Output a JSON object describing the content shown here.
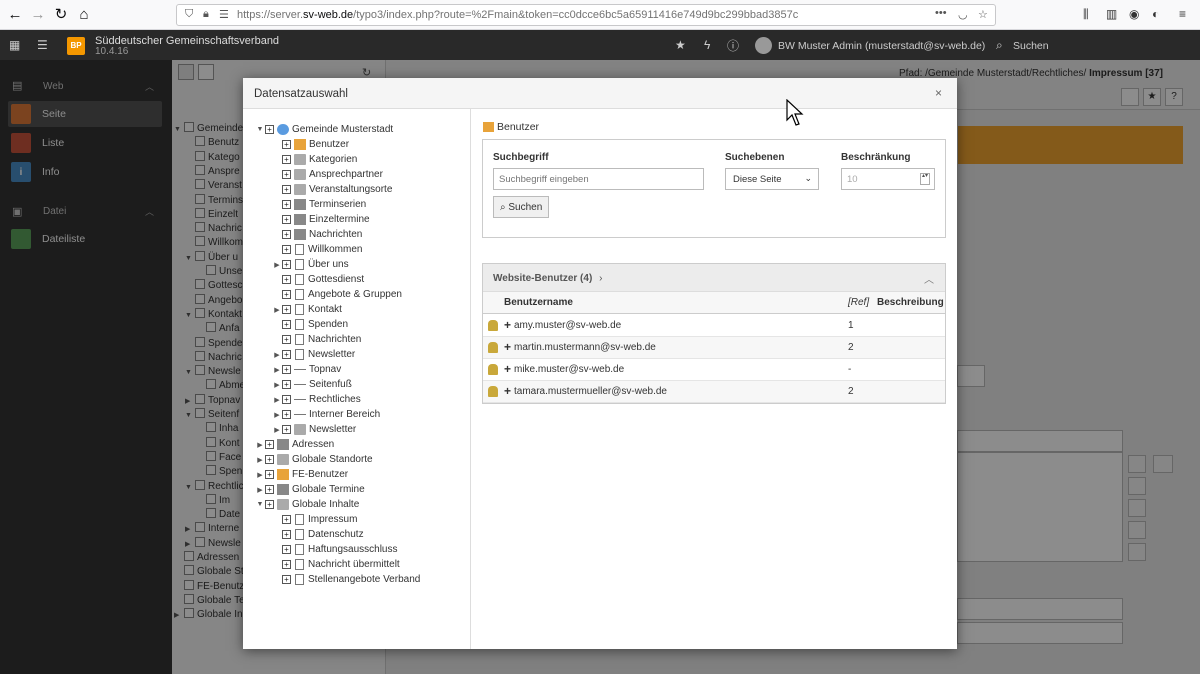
{
  "browser": {
    "url_prefix": "https://server.",
    "url_domain": "sv-web.de",
    "url_path": "/typo3/index.php?route=%2Fmain&token=cc0dcce6bc5a65911416e749d9bc299bbad3857c",
    "menu_dots": "•••"
  },
  "topbar": {
    "logo_text": "BP",
    "site_name": "Süddeutscher Gemeinschaftsverband",
    "site_version": "10.4.16",
    "user": "BW Muster Admin (musterstadt@sv-web.de)",
    "search_label": "Suchen"
  },
  "modules": {
    "group_web": "Web",
    "seite": "Seite",
    "liste": "Liste",
    "info": "Info",
    "group_datei": "Datei",
    "dateiliste": "Dateiliste",
    "colors": {
      "seite": "#e07b39",
      "liste": "#c8553d",
      "info": "#4a8ec9",
      "dateiliste": "#5ca35c"
    }
  },
  "bg_tree": [
    "Gemeinde",
    "Benutz",
    "Katego",
    "Anspre",
    "Veranst",
    "Termins",
    "Einzelt",
    "Nachric",
    "Willkom",
    "Über u",
    "Unse",
    "Gottesc",
    "Angebo",
    "Kontakt",
    "Anfa",
    "Spende",
    "Nachric",
    "Newsle",
    "Abme",
    "Topnav",
    "Seitenf",
    "Inha",
    "Kont",
    "Face",
    "Spen",
    "Rechtlic",
    "Im",
    "Date",
    "Interne",
    "Newsle",
    "Adressen",
    "Globale St",
    "FE-Benutz",
    "Globale Te",
    "Globale In"
  ],
  "docheader": {
    "path_label": "Pfad: /Gemeinde Musterstadt/Rechtliches/",
    "page": "Impressum [37]"
  },
  "modal": {
    "title": "Datensatzauswahl",
    "close": "×",
    "tree": [
      {
        "label": "Gemeinde Musterstadt",
        "icon": "globe",
        "level": 0,
        "arrow": "▼"
      },
      {
        "label": "Benutzer",
        "icon": "user",
        "level": 1,
        "arrow": ""
      },
      {
        "label": "Kategorien",
        "icon": "folder",
        "level": 1,
        "arrow": ""
      },
      {
        "label": "Ansprechpartner",
        "icon": "folder",
        "level": 1,
        "arrow": ""
      },
      {
        "label": "Veranstaltungsorte",
        "icon": "folder",
        "level": 1,
        "arrow": ""
      },
      {
        "label": "Terminserien",
        "icon": "sys",
        "level": 1,
        "arrow": ""
      },
      {
        "label": "Einzeltermine",
        "icon": "sys",
        "level": 1,
        "arrow": ""
      },
      {
        "label": "Nachrichten",
        "icon": "sys",
        "level": 1,
        "arrow": ""
      },
      {
        "label": "Willkommen",
        "icon": "page",
        "level": 1,
        "arrow": ""
      },
      {
        "label": "Über uns",
        "icon": "page",
        "level": 1,
        "arrow": "▶"
      },
      {
        "label": "Gottesdienst",
        "icon": "page",
        "level": 1,
        "arrow": ""
      },
      {
        "label": "Angebote & Gruppen",
        "icon": "page",
        "level": 1,
        "arrow": ""
      },
      {
        "label": "Kontakt",
        "icon": "page",
        "level": 1,
        "arrow": "▶"
      },
      {
        "label": "Spenden",
        "icon": "page",
        "level": 1,
        "arrow": ""
      },
      {
        "label": "Nachrichten",
        "icon": "page",
        "level": 1,
        "arrow": ""
      },
      {
        "label": "Newsletter",
        "icon": "page",
        "level": 1,
        "arrow": "▶"
      },
      {
        "label": "Topnav",
        "icon": "sep",
        "level": 1,
        "arrow": "▶"
      },
      {
        "label": "Seitenfuß",
        "icon": "sep",
        "level": 1,
        "arrow": "▶"
      },
      {
        "label": "Rechtliches",
        "icon": "sep",
        "level": 1,
        "arrow": "▶"
      },
      {
        "label": "Interner Bereich",
        "icon": "sep",
        "level": 1,
        "arrow": "▶"
      },
      {
        "label": "Newsletter",
        "icon": "folder",
        "level": 1,
        "arrow": "▶"
      },
      {
        "label": "Adressen",
        "icon": "sys",
        "level": 0,
        "arrow": "▶"
      },
      {
        "label": "Globale Standorte",
        "icon": "folder",
        "level": 0,
        "arrow": "▶"
      },
      {
        "label": "FE-Benutzer",
        "icon": "user",
        "level": 0,
        "arrow": "▶"
      },
      {
        "label": "Globale Termine",
        "icon": "sys",
        "level": 0,
        "arrow": "▶"
      },
      {
        "label": "Globale Inhalte",
        "icon": "folder",
        "level": 0,
        "arrow": "▼"
      },
      {
        "label": "Impressum",
        "icon": "page",
        "level": 1,
        "arrow": ""
      },
      {
        "label": "Datenschutz",
        "icon": "page",
        "level": 1,
        "arrow": ""
      },
      {
        "label": "Haftungsausschluss",
        "icon": "page",
        "level": 1,
        "arrow": ""
      },
      {
        "label": "Nachricht übermittelt",
        "icon": "page",
        "level": 1,
        "arrow": ""
      },
      {
        "label": "Stellenangebote Verband",
        "icon": "page",
        "level": 1,
        "arrow": ""
      }
    ],
    "panel_title": "Benutzer",
    "search": {
      "term_label": "Suchbegriff",
      "term_placeholder": "Suchbegriff eingeben",
      "levels_label": "Suchebenen",
      "levels_value": "Diese Seite",
      "limit_label": "Beschränkung",
      "limit_value": "10",
      "button": "Suchen"
    },
    "results": {
      "title": "Website-Benutzer (4)",
      "col_username": "Benutzername",
      "col_ref": "[Ref]",
      "col_desc": "Beschreibung",
      "rows": [
        {
          "username": "amy.muster@sv-web.de",
          "ref": "1"
        },
        {
          "username": "martin.mustermann@sv-web.de",
          "ref": "2"
        },
        {
          "username": "mike.muster@sv-web.de",
          "ref": "-"
        },
        {
          "username": "tamara.mustermueller@sv-web.de",
          "ref": "2"
        }
      ]
    }
  }
}
